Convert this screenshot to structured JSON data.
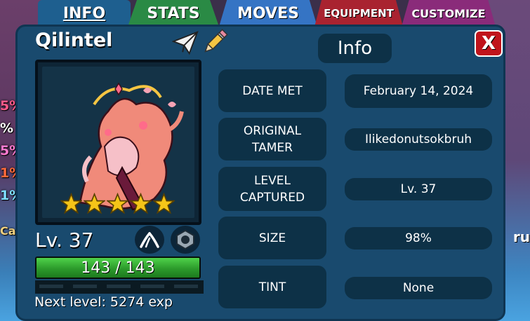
{
  "tabs": [
    "INFO",
    "STATS",
    "MOVES",
    "EQUIPMENT",
    "CUSTOMIZE"
  ],
  "creature": {
    "name": "Qilintel",
    "level": "Lv. 37",
    "stars": 5,
    "hp": "143 / 143",
    "hp_fraction": 1.0,
    "next_level": "Next level: 5274 exp"
  },
  "panel": {
    "title": "Info",
    "close_label": "X"
  },
  "info_rows": [
    {
      "label": "DATE MET",
      "value": "February 14, 2024"
    },
    {
      "label": "ORIGINAL\nTAMER",
      "value": "Ilikedonutsokbruh"
    },
    {
      "label": "LEVEL\nCAPTURED",
      "value": "Lv. 37"
    },
    {
      "label": "SIZE",
      "value": "98%"
    },
    {
      "label": "TINT",
      "value": "None"
    }
  ],
  "background_fragments": {
    "left_percents": [
      "5%",
      "%",
      "5%",
      "1%",
      "1%"
    ],
    "left_bottom": "Ca",
    "right_bottom": "ru"
  },
  "colors": {
    "panel": "#194a6e",
    "row_bg": "#0d3147",
    "hp_fill": "#2c9a2b",
    "close_button": "#c0141c",
    "star": "#f5c518"
  }
}
